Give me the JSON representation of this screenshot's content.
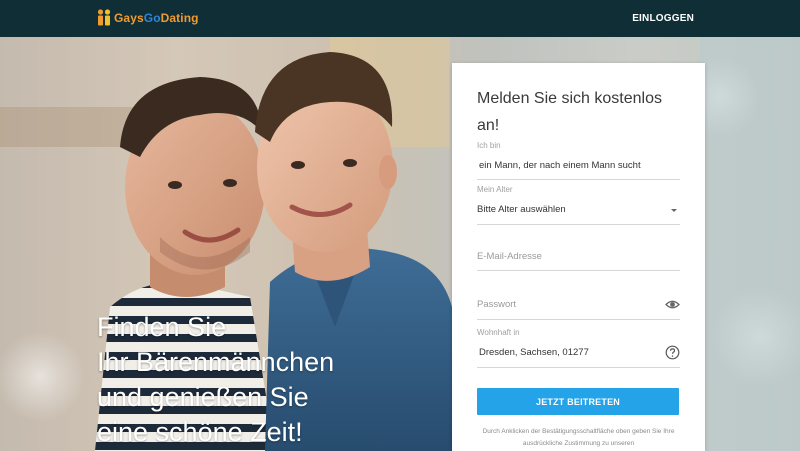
{
  "header": {
    "brand": {
      "part1": "Gays",
      "part2": "Go",
      "part3": "Dating"
    },
    "login_label": "EINLOGGEN"
  },
  "hero": {
    "headline_lines": [
      "Finden Sie",
      "Ihr Bärenmännchen",
      "und genießen Sie",
      "eine schöne Zeit!"
    ]
  },
  "signup": {
    "title": "Melden Sie sich kostenlos an!",
    "seeking": {
      "label": "Ich bin",
      "value": "ein Mann, der nach einem Mann sucht"
    },
    "age": {
      "label": "Mein Alter",
      "value": "Bitte Alter auswählen"
    },
    "email": {
      "placeholder": "E-Mail-Adresse"
    },
    "password": {
      "placeholder": "Passwort",
      "icon": "eye-icon"
    },
    "location": {
      "label": "Wohnhaft in",
      "value": "Dresden, Sachsen, 01277",
      "icon": "help-icon"
    },
    "submit_label": "JETZT BEITRETEN",
    "legal_text": "Durch Anklicken der Bestätigungsschaltfläche oben geben Sie Ihre ausdrückliche Zustimmung zu unseren"
  },
  "colors": {
    "header_bg": "#0f2e36",
    "brand_orange": "#f29a2e",
    "brand_blue": "#2f86d8",
    "button_blue": "#24a3e8"
  }
}
